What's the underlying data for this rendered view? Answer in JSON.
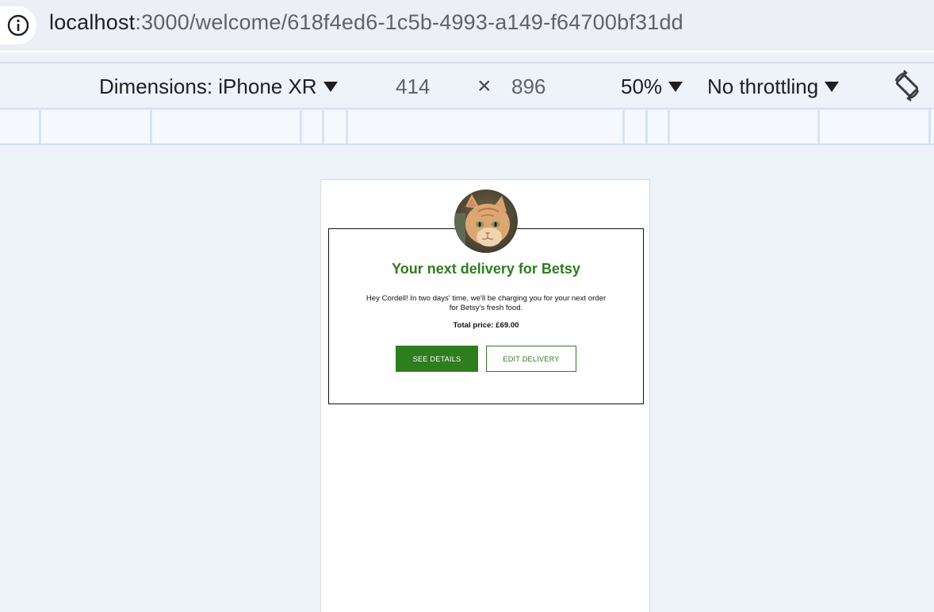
{
  "browser": {
    "url_host": "localhost",
    "url_path": ":3000/welcome/618f4ed6-1c5b-4993-a149-f64700bf31dd"
  },
  "device_toolbar": {
    "dimensions_label": "Dimensions: iPhone XR",
    "width": "414",
    "times": "×",
    "height": "896",
    "zoom": "50%",
    "throttling": "No throttling"
  },
  "page": {
    "title": "Your next delivery for Betsy",
    "body": "Hey Cordell! In two days' time, we'll be charging you for your next order for Betsy's fresh food.",
    "total": "Total price: £69.00",
    "see_details": "SEE DETAILS",
    "edit_delivery": "EDIT DELIVERY"
  },
  "colors": {
    "accent": "#2e7d1f",
    "chrome_bg": "#eef2f9"
  }
}
